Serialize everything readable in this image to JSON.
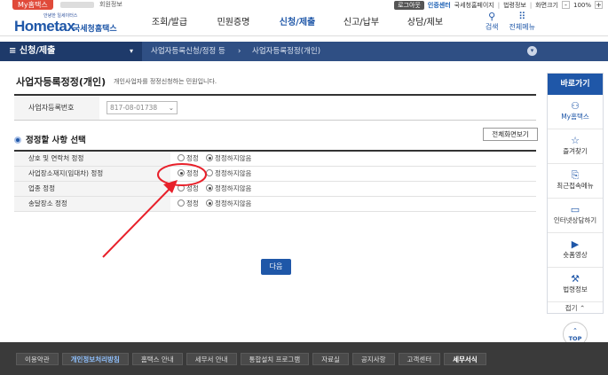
{
  "util": {
    "my_badge": "My홈택스",
    "user_info": "회원정보",
    "logout": "로그아웃",
    "cert_center": "인증센터",
    "national_tax_home": "국세청홈페이지",
    "law_info": "법령정보",
    "zoom_label": "화면크기",
    "zoom_minus": "-",
    "zoom_value": "100%",
    "zoom_plus": "+"
  },
  "header": {
    "logo_small": "안녕한 일세이터스",
    "logo_main": "Hometax",
    "logo_kor": "국세청홈택스",
    "menu": [
      "조회/발급",
      "민원증명",
      "신청/제출",
      "신고/납부",
      "상담/제보"
    ],
    "active_menu": "신청/제출",
    "search_label": "검색",
    "allmenu_label": "전체메뉴"
  },
  "location": {
    "current": "신청/제출",
    "crumbs": [
      "사업자등록신청/정정 등",
      "사업자등록정정(개인)"
    ]
  },
  "page": {
    "title": "사업자등록정정(개인)",
    "desc": "개인사업자를 정정신청하는 민원입니다.",
    "bizno_label": "사업자등록번호",
    "bizno_value": "817-08-01738",
    "section_title": "정정할 사항 선택",
    "full_screen_btn": "전체화면보기",
    "option_rows": [
      {
        "label": "상호 및 연락처 정정",
        "opt1": "정정",
        "opt2": "정정하지않음",
        "selected": "opt2"
      },
      {
        "label": "사업장소재지(임대차) 정정",
        "opt1": "정정",
        "opt2": "정정하지않음",
        "selected": "opt1"
      },
      {
        "label": "업종 정정",
        "opt1": "정정",
        "opt2": "정정하지않음",
        "selected": "opt2"
      },
      {
        "label": "송달장소 정정",
        "opt1": "정정",
        "opt2": "정정하지않음",
        "selected": "opt2"
      }
    ],
    "next_btn": "다음"
  },
  "quick_menu": {
    "title": "바로가기",
    "items": [
      {
        "label": "My홈택스",
        "icon": "person-icon"
      },
      {
        "label": "즐겨찾기",
        "icon": "star-icon"
      },
      {
        "label": "최근접속메뉴",
        "icon": "recent-icon"
      },
      {
        "label": "인터넷상담하기",
        "icon": "monitor-icon"
      },
      {
        "label": "숏폼영상",
        "icon": "play-icon"
      },
      {
        "label": "법령정보",
        "icon": "gavel-icon"
      }
    ],
    "fold": "접기",
    "top": "TOP"
  },
  "footer": {
    "links": [
      "이용약관",
      "개인정보처리방침",
      "홈택스 안내",
      "세무서 안내",
      "통합설치 프로그램",
      "자료실",
      "공지사항",
      "고객센터",
      "세무서식"
    ]
  },
  "colors": {
    "brand_blue": "#1f57a8",
    "nav_dark": "#2f4f84",
    "annotation_red": "#e8202a"
  }
}
